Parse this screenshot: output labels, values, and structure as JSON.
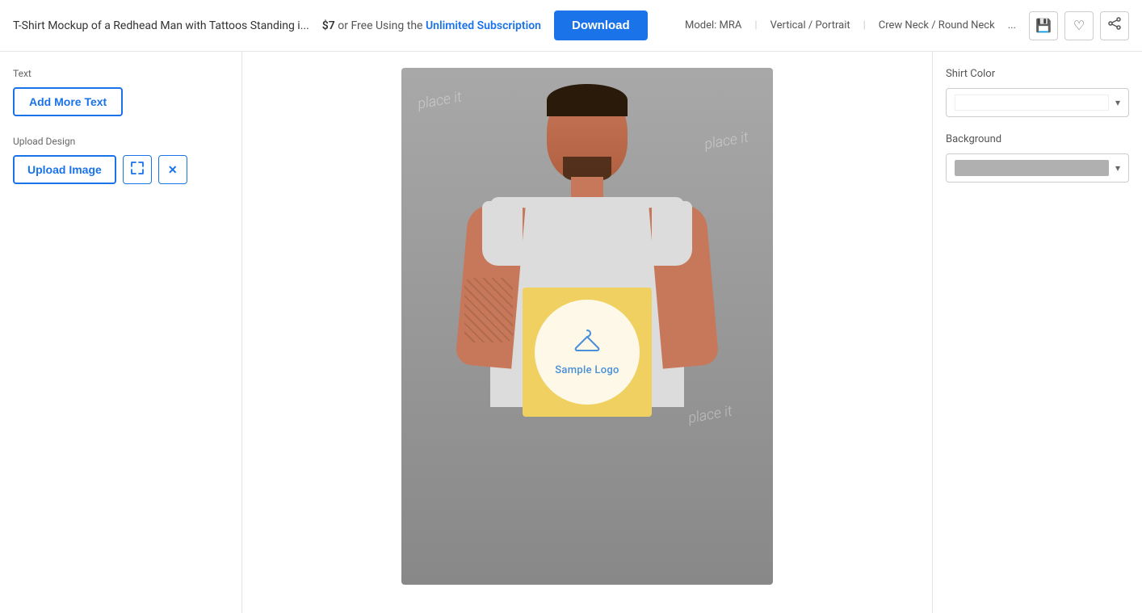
{
  "header": {
    "title": "T-Shirt Mockup of a Redhead Man with Tattoos Standing i...",
    "price_display": "$7",
    "price_text": "or Free Using the",
    "subscription_label": "Unlimited Subscription",
    "download_label": "Download",
    "model_label": "Model: MRA",
    "orientation_label": "Vertical / Portrait",
    "neck_label": "Crew Neck / Round Neck",
    "more_label": "..."
  },
  "icons": {
    "save": "💾",
    "heart": "♡",
    "share": "⬡",
    "resize": "⤢",
    "close": "✕",
    "chevron_down": "▾"
  },
  "left_panel": {
    "text_section_label": "Text",
    "add_more_text_label": "Add More Text",
    "upload_section_label": "Upload Design",
    "upload_image_label": "Upload Image"
  },
  "canvas": {
    "watermarks": [
      "place it",
      "place it",
      "place it"
    ],
    "sample_logo_text": "Sample Logo"
  },
  "right_panel": {
    "shirt_color_label": "Shirt Color",
    "background_label": "Background"
  }
}
